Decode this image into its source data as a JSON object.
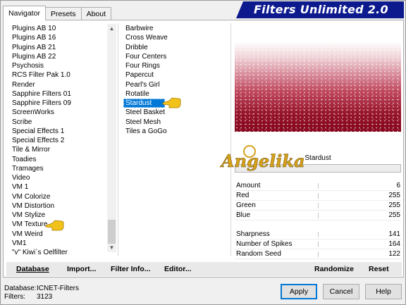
{
  "tabs": [
    {
      "label": "Navigator",
      "active": true
    },
    {
      "label": "Presets",
      "active": false
    },
    {
      "label": "About",
      "active": false
    }
  ],
  "banner": {
    "title": "Filters Unlimited 2.0",
    "color": "#0c1a8e"
  },
  "categories": [
    "Plugins AB 10",
    "Plugins AB 16",
    "Plugins AB 21",
    "Plugins AB 22",
    "Psychosis",
    "RCS Filter Pak 1.0",
    "Render",
    "Sapphire Filters 01",
    "Sapphire Filters 09",
    "ScreenWorks",
    "Scribe",
    "Special Effects 1",
    "Special Effects 2",
    "Tile & Mirror",
    "Toadies",
    "Tramages",
    "Video",
    "VM 1",
    "VM Colorize",
    "VM Distortion",
    "VM Stylize",
    "VM Texture",
    "VM Weird",
    "VM1",
    "\"v\" Kiwi`s Oelfilter"
  ],
  "selected_category": "VM Texture",
  "filters": [
    "Barbwire",
    "Cross Weave",
    "Dribble",
    "Four Centers",
    "Four Rings",
    "Papercut",
    "Pearl's Girl",
    "Rotatile",
    "Stardust",
    "Steel Basket",
    "Steel Mesh",
    "Tiles a GoGo"
  ],
  "selected_filter": "Stardust",
  "preview": {
    "filter_name": "Stardust"
  },
  "params": [
    {
      "label": "Amount",
      "value": "6"
    },
    {
      "label": "Red",
      "value": "255"
    },
    {
      "label": "Green",
      "value": "255"
    },
    {
      "label": "Blue",
      "value": "255"
    }
  ],
  "params2": [
    {
      "label": "Sharpness",
      "value": "141"
    },
    {
      "label": "Number of Spikes",
      "value": "164"
    },
    {
      "label": "Random Seed",
      "value": "122"
    }
  ],
  "panel_buttons": {
    "database": "Database",
    "import": "Import...",
    "filter_info": "Filter Info...",
    "editor": "Editor...",
    "randomize": "Randomize",
    "reset": "Reset"
  },
  "status": {
    "database_label": "Database:",
    "database_value": "ICNET-Filters",
    "filters_label": "Filters:",
    "filters_value": "3123"
  },
  "dialog_buttons": {
    "apply": "Apply",
    "cancel": "Cancel",
    "help": "Help"
  },
  "watermark": "Angelika",
  "colors": {
    "selection": "#0078d7",
    "hand": "#f2c21a",
    "watermark": "#d7a21a"
  }
}
